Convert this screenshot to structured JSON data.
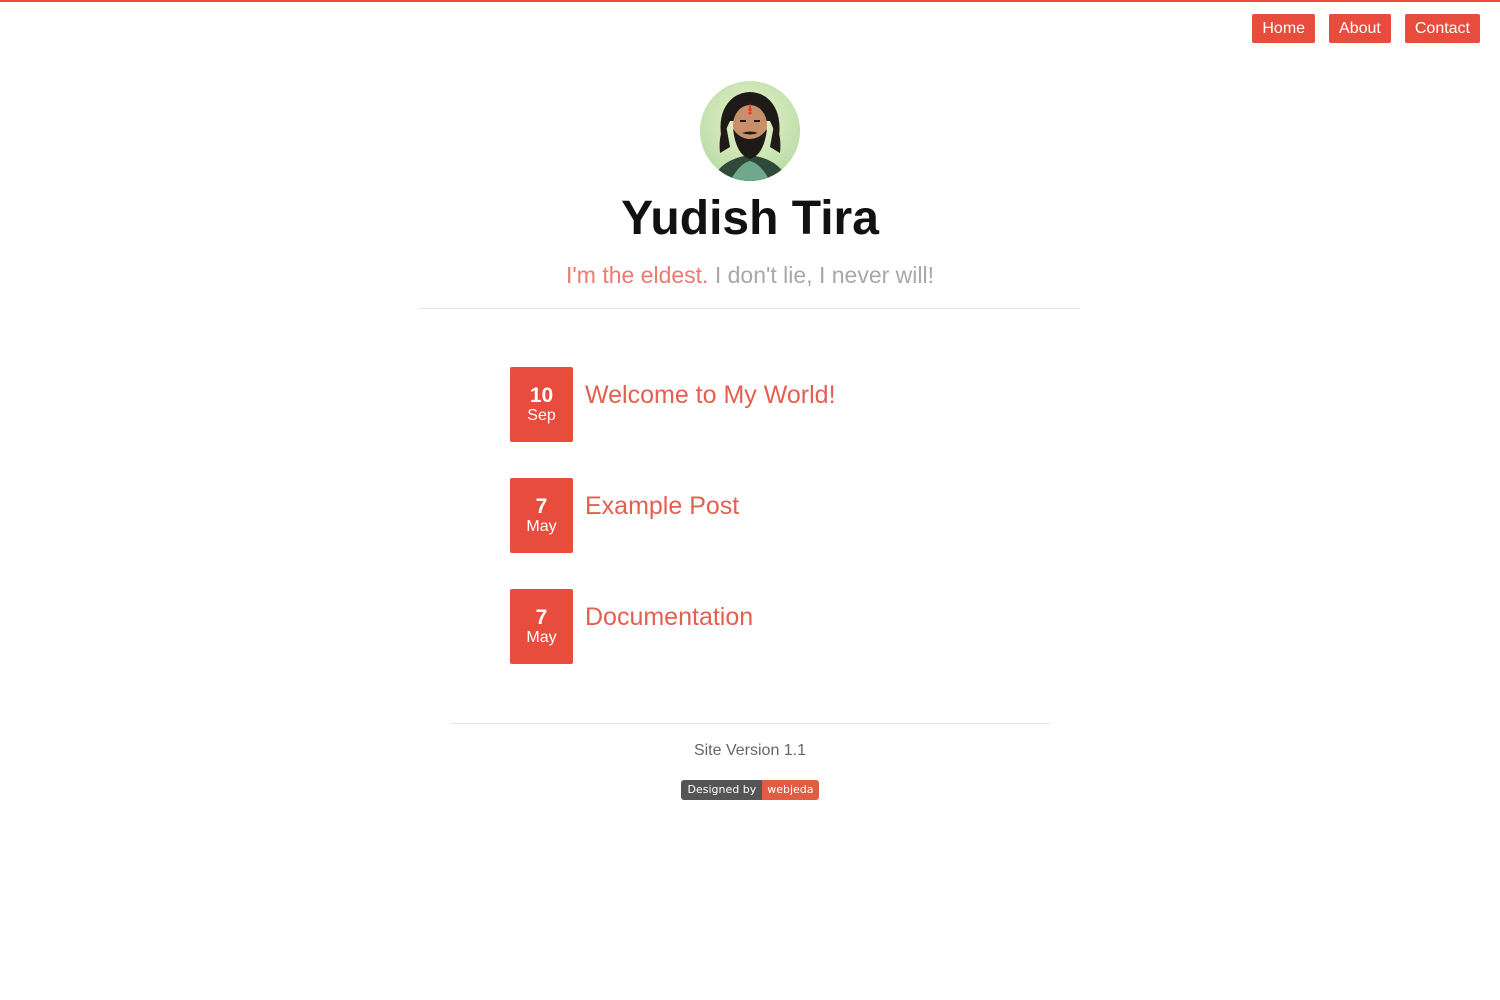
{
  "nav": {
    "items": [
      {
        "label": "Home"
      },
      {
        "label": "About"
      },
      {
        "label": "Contact"
      }
    ]
  },
  "header": {
    "title": "Yudish Tira",
    "tagline_accent": "I'm the eldest.",
    "tagline_rest": "I don't lie, I never will!"
  },
  "posts": [
    {
      "day": "10",
      "month": "Sep",
      "title": "Welcome to My World!"
    },
    {
      "day": "7",
      "month": "May",
      "title": "Example Post"
    },
    {
      "day": "7",
      "month": "May",
      "title": "Documentation"
    }
  ],
  "footer": {
    "version": "Site Version 1.1",
    "badge_left": "Designed by",
    "badge_right": "webjeda"
  },
  "colors": {
    "accent": "#e74c3c",
    "post_title": "#e45f50",
    "tagline_accent": "#ec7a6e",
    "tagline_rest": "#a8a8a8"
  }
}
